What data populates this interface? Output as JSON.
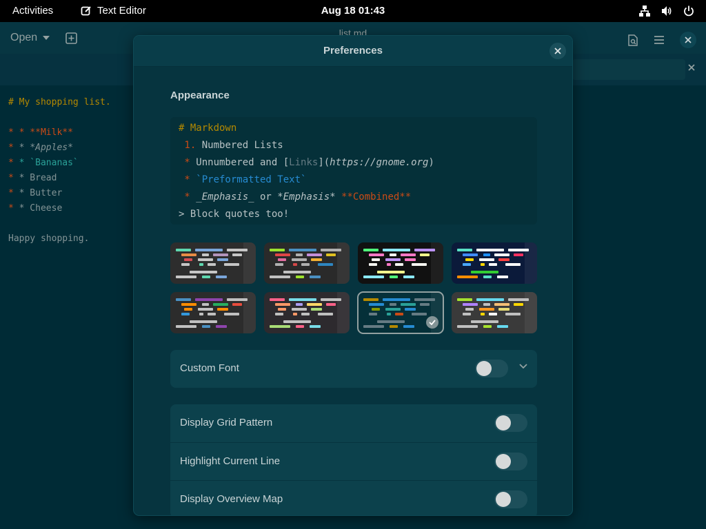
{
  "topbar": {
    "activities": "Activities",
    "app_name": "Text Editor",
    "clock": "Aug 18  01:43",
    "tray_icons": [
      "network-icon",
      "volume-icon",
      "power-icon"
    ]
  },
  "editor": {
    "open_label": "Open",
    "doc_title": "list.md",
    "lines": [
      "# My shopping list.",
      "",
      "* **Milk**",
      "* *Apples*",
      "* `Bananas`",
      "* Bread",
      "* Butter",
      "* Cheese",
      "",
      "Happy shopping."
    ]
  },
  "dialog": {
    "title": "Preferences",
    "section": "Appearance",
    "preview": {
      "line1": "# Markdown",
      "line2_num": " 1.",
      "line2_text": " Numbered Lists",
      "line3_bullet": " *",
      "line3_a": " Unnumbered and [",
      "line3_link": "Links",
      "line3_b": "](",
      "line3_url": "https://gnome.org",
      "line3_c": ")",
      "line4_bullet": " *",
      "line4_code": " `Preformatted Text`",
      "line5_bullet": " *",
      "line5_em1": " _Emphasis_",
      "line5_or": " or ",
      "line5_em2": "*Emphasis*",
      "line5_strong": " **Combined**",
      "line6": "> Block quotes too!"
    },
    "schemes": [
      {
        "bg": "#2d2d2d",
        "colors": [
          "#5fd7af",
          "#7aa6da",
          "#c6c6c6",
          "#e78c45",
          "#c6c6c6",
          "#b294bb",
          "#c6c6c6",
          "#d54e53",
          "#c6c6c6",
          "#7aa6da",
          "#c6c6c6",
          "#5fd7af",
          "#c6c6c6",
          "#c6c6c6",
          "#c6c6c6",
          "#c6c6c6"
        ]
      },
      {
        "bg": "#2a2a2a",
        "colors": [
          "#9ce22e",
          "#4a90c2",
          "#b0b0b0",
          "#e04646",
          "#b0b0b0",
          "#c38fd9",
          "#e0c020",
          "#e06c9f",
          "#b0b0b0",
          "#f2b134",
          "#b0b0b0",
          "#d44848",
          "#b0b0b0",
          "#2e86c1",
          "#c0c0c0",
          "#c0c0c0"
        ]
      },
      {
        "bg": "#111111",
        "colors": [
          "#50fa7b",
          "#8be9fd",
          "#bd93f9",
          "#ff79c6",
          "#f8f8f2",
          "#ff79c6",
          "#f1fa8c",
          "#f8f8f2",
          "#bd93f9",
          "#ff79c6",
          "#f8f8f2",
          "#ff79c6",
          "#f8f8f2",
          "#f8f8f2",
          "#f1fa8c",
          "#8be9fd"
        ]
      },
      {
        "bg": "#0b1a3a",
        "colors": [
          "#59e0c5",
          "#ffffff",
          "#ffffff",
          "#3f8cff",
          "#1e90ff",
          "#ffffff",
          "#ff3060",
          "#ffd700",
          "#ffffff",
          "#ff4040",
          "#4aa8ff",
          "#ffd700",
          "#ffffff",
          "#ffffff",
          "#32cd32",
          "#ff8c00"
        ]
      },
      {
        "bg": "#2c2c2c",
        "colors": [
          "#4a90c2",
          "#8e44ad",
          "#c0c0c0",
          "#ff8c00",
          "#c0c0c0",
          "#27ae60",
          "#e74c3c",
          "#ff8c00",
          "#c0c0c0",
          "#ff8c00",
          "#3498db",
          "#c0c0c0",
          "#c0c0c0",
          "#c0c0c0",
          "#c0c0c0",
          "#c0c0c0"
        ]
      },
      {
        "bg": "#2d2a2e",
        "colors": [
          "#ff6188",
          "#78dce8",
          "#c0c0c0",
          "#fc9867",
          "#ab9df2",
          "#ffd866",
          "#ff6188",
          "#fc9867",
          "#c0c0c0",
          "#a9dc76",
          "#c0c0c0",
          "#fc9867",
          "#c0c0c0",
          "#c0c0c0",
          "#c0c0c0",
          "#a9dc76"
        ]
      },
      {
        "bg": "#053039",
        "colors": [
          "#b58900",
          "#268bd2",
          "#657b83",
          "#268bd2",
          "#657b83",
          "#2aa198",
          "#657b83",
          "#859900",
          "#2aa198",
          "#268bd2",
          "#657b83",
          "#2aa198",
          "#cb4b16",
          "#657b83",
          "#657b83",
          "#657b83"
        ]
      },
      {
        "bg": "#3a3a3a",
        "colors": [
          "#a6e22e",
          "#66d9ef",
          "#c0c0c0",
          "#ae81ff",
          "#c0c0c0",
          "#f4bf75",
          "#ffd700",
          "#c0c0c0",
          "#fd971f",
          "#e6db74",
          "#c0c0c0",
          "#ffd700",
          "#ffffff",
          "#c0c0c0",
          "#c0c0c0",
          "#c0c0c0"
        ]
      }
    ],
    "selected_scheme": 6,
    "custom_font_label": "Custom Font",
    "toggles": [
      {
        "label": "Display Grid Pattern"
      },
      {
        "label": "Highlight Current Line"
      },
      {
        "label": "Display Overview Map"
      }
    ]
  }
}
